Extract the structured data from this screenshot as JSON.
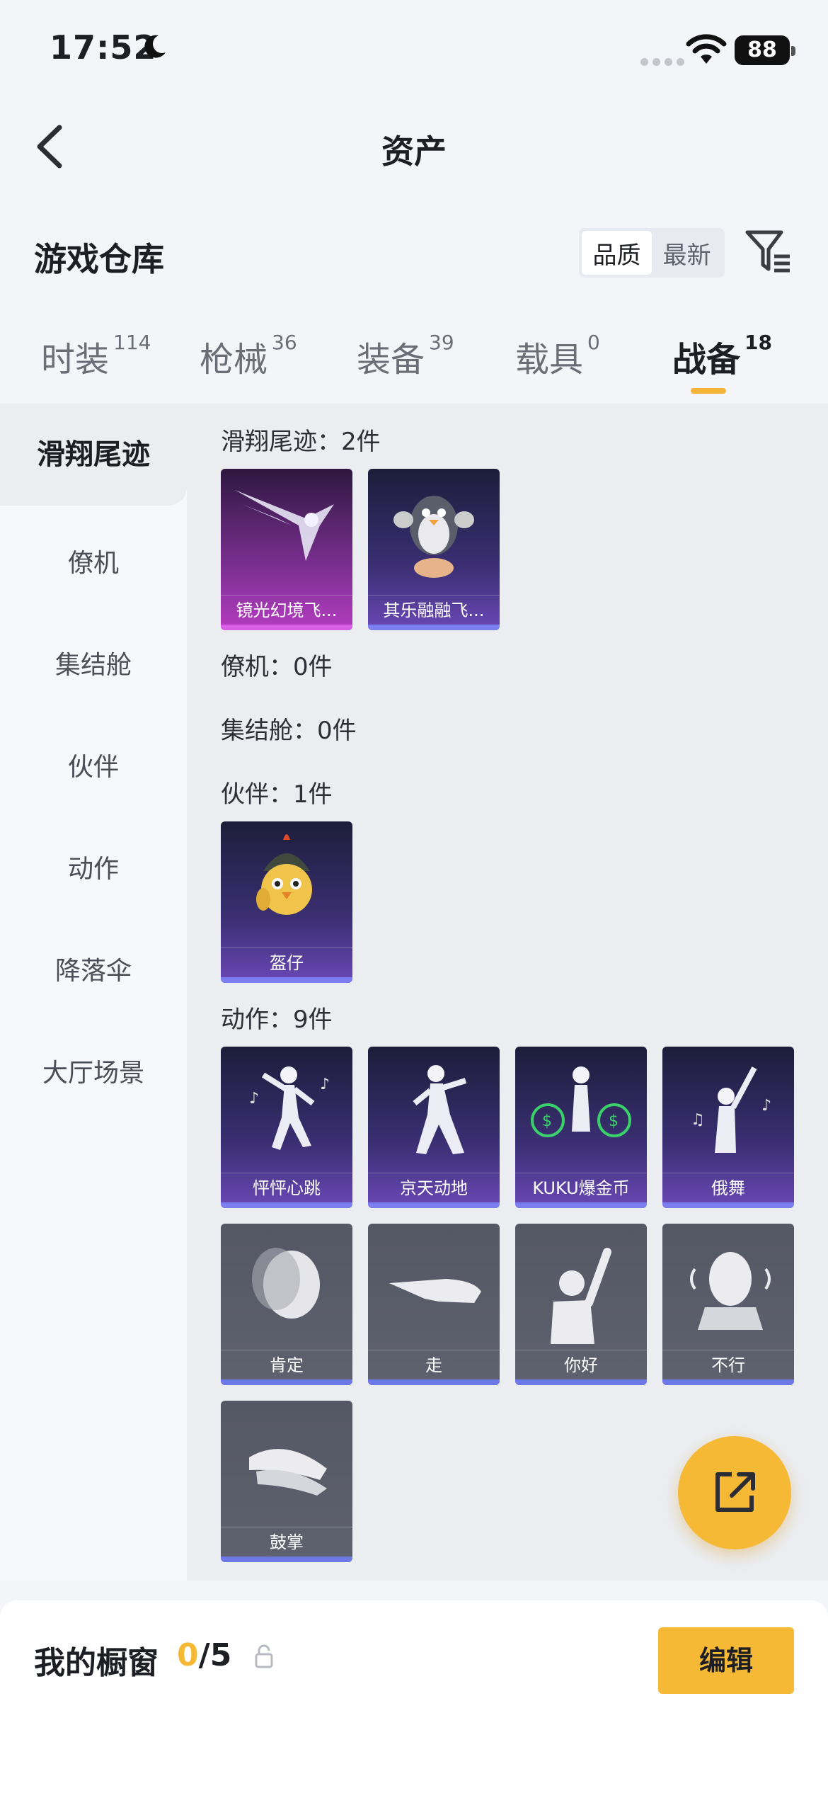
{
  "status_bar": {
    "time": "17:52",
    "battery": "88"
  },
  "nav": {
    "title": "资产"
  },
  "section": {
    "title": "游戏仓库",
    "sort_options": [
      "品质",
      "最新"
    ]
  },
  "tabs": [
    {
      "label": "时装",
      "count": "114"
    },
    {
      "label": "枪械",
      "count": "36"
    },
    {
      "label": "装备",
      "count": "39"
    },
    {
      "label": "载具",
      "count": "0"
    },
    {
      "label": "战备",
      "count": "18"
    }
  ],
  "sidebar": [
    "滑翔尾迹",
    "僚机",
    "集结舱",
    "伙伴",
    "动作",
    "降落伞",
    "大厅场景"
  ],
  "groups": [
    {
      "title": "滑翔尾迹：2件",
      "items": [
        "镜光幻境飞...",
        "其乐融融飞..."
      ]
    },
    {
      "title": "僚机：0件",
      "items": []
    },
    {
      "title": "集结舱：0件",
      "items": []
    },
    {
      "title": "伙伴：1件",
      "items": [
        "盔仔"
      ]
    },
    {
      "title": "动作：9件",
      "items": [
        "怦怦心跳",
        "京天动地",
        "KUKU爆金币",
        "俄舞",
        "肯定",
        "走",
        "你好",
        "不行",
        "鼓掌"
      ]
    }
  ],
  "showcase": {
    "label": "我的橱窗",
    "current": "0",
    "total": "/5",
    "edit_label": "编辑"
  },
  "colors": {
    "accent": "#f5b935",
    "bar": "#7b7df0",
    "tab_underline": "#f5b53a"
  }
}
